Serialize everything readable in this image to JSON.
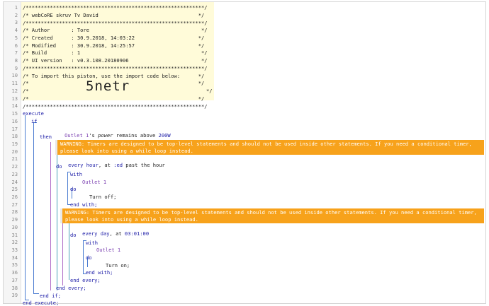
{
  "header": {
    "star_border": "/***********************************************************/",
    "star_border_end": "/***********************************************************/",
    "title_line": "/* webCoRE skruv Tv David                                 */",
    "author": "/* Author       : Tore                                     */",
    "created": "/* Created      : 30.9.2018, 14:03:22                     */",
    "modified": "/* Modified     : 30.9.2018, 14:25:57                     */",
    "build": "/* Build        : 1                                        */",
    "ui_version": "/* UI version   : v0.3.108.20180906                        */",
    "import_line": "/* To import this piston, use the import code below:      */",
    "blank_line": "/*                                                        */",
    "import_prefix": "/*",
    "import_code": "5netr",
    "import_suffix": "*/"
  },
  "line_numbers": [
    "1",
    "2",
    "3",
    "4",
    "5",
    "6",
    "7",
    "8",
    "9",
    "10",
    "11",
    "12",
    "13",
    "14",
    "15",
    "16",
    "17",
    "18",
    "19",
    "20",
    "21",
    "22",
    "23",
    "24",
    "25",
    "26",
    "27",
    "28",
    "29",
    "30",
    "31",
    "32",
    "33",
    "34",
    "35",
    "36",
    "37",
    "38",
    "39"
  ],
  "code": {
    "execute": "execute",
    "if": "if",
    "condition_device": "Outlet 1",
    "condition_possessive": "'s",
    "condition_attr": "power",
    "condition_op": "remains above",
    "condition_value": "200W",
    "then": "then",
    "warning_text": "WARNING: Timers are designed to be top-level statements and should not be used inside other statements. If you need a conditional timer, please look into using a while loop instead.",
    "every1_kw": "every",
    "every1_unit": "hour",
    "every1_at": ", at",
    "every1_time": ":ed",
    "every1_suffix": "past the hour",
    "do": "do",
    "with": "with",
    "device1": "Outlet 1",
    "cmd_off": "Turn off;",
    "end_with": "end with;",
    "every2_kw": "every",
    "every2_unit": "day",
    "every2_at": ", at",
    "every2_time": "03:01:00",
    "device2": "Outlet 1",
    "cmd_on": "Turn on;",
    "end_every": "end every;",
    "end_if": "end if;",
    "end_execute": "end execute;"
  }
}
